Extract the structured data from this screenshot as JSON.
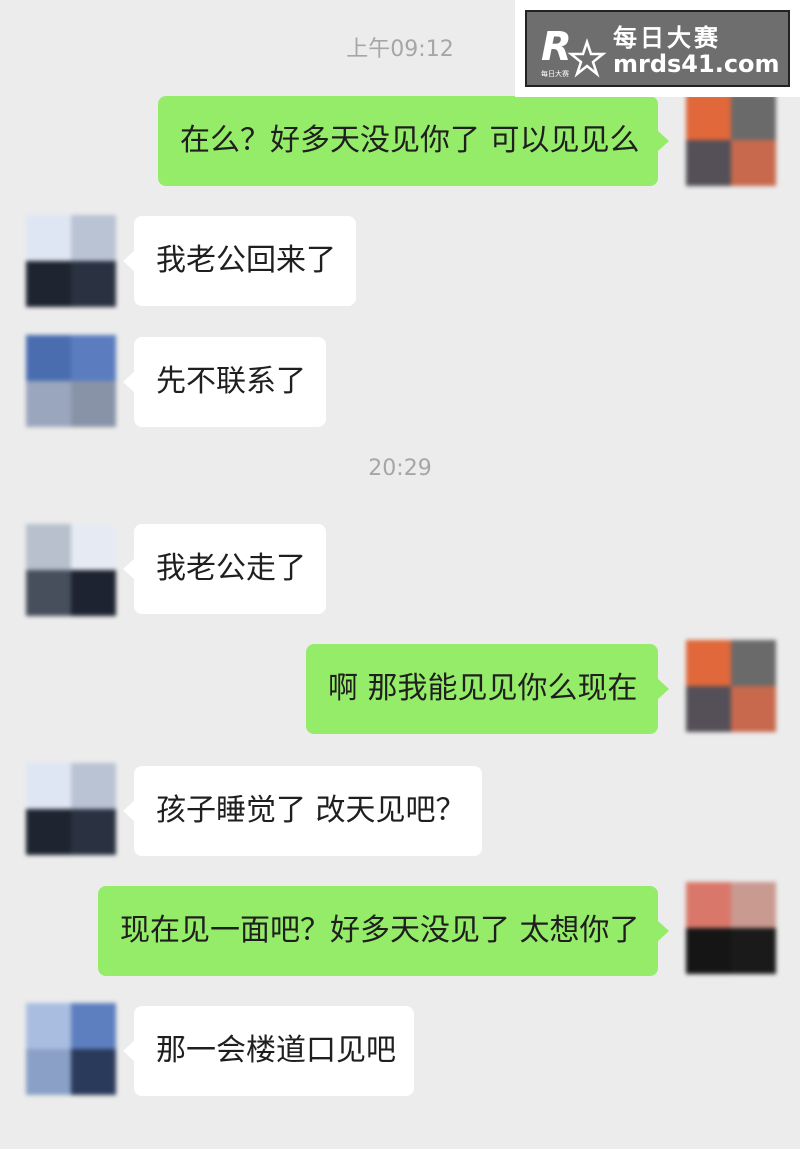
{
  "watermark": {
    "title": "每日大赛",
    "domain": "mrds41.com",
    "logo_letter": "R",
    "logo_small": "每日大赛"
  },
  "timestamps": [
    "上午09:12",
    "20:29"
  ],
  "messages": [
    {
      "direction": "out",
      "text": "在么？好多天没见你了 可以见见么"
    },
    {
      "direction": "in",
      "text": "我老公回来了"
    },
    {
      "direction": "in",
      "text": "先不联系了"
    },
    {
      "direction": "in",
      "text": "我老公走了"
    },
    {
      "direction": "out",
      "text": "啊 那我能见见你么现在"
    },
    {
      "direction": "in",
      "text": "孩子睡觉了 改天见吧？"
    },
    {
      "direction": "out",
      "text": "现在见一面吧？好多天没见了 太想你了"
    },
    {
      "direction": "in",
      "text": "那一会楼道口见吧"
    }
  ],
  "colors": {
    "background": "#ececec",
    "outgoing_bubble": "#95ec69",
    "incoming_bubble": "#ffffff",
    "timestamp": "#a6a6a6"
  }
}
